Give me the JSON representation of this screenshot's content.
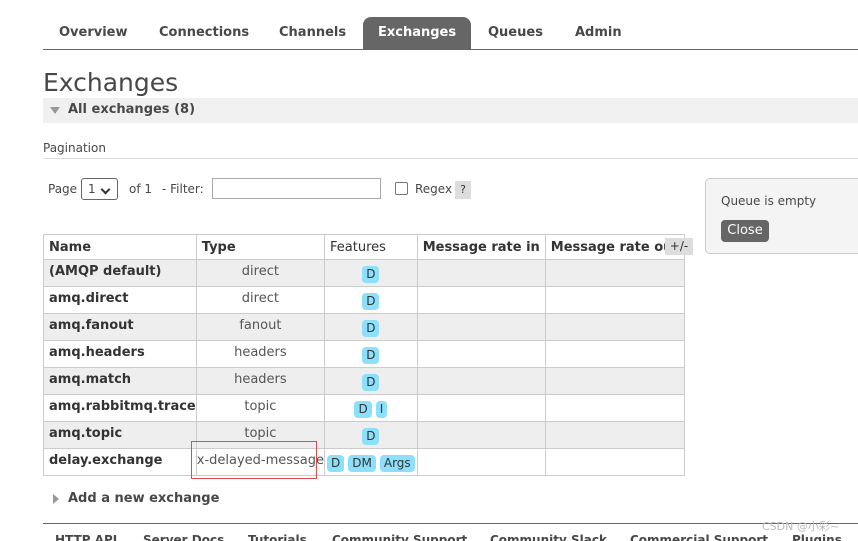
{
  "tabs": [
    {
      "label": "Overview"
    },
    {
      "label": "Connections"
    },
    {
      "label": "Channels"
    },
    {
      "label": "Exchanges",
      "active": true
    },
    {
      "label": "Queues"
    },
    {
      "label": "Admin"
    }
  ],
  "page_title": "Exchanges",
  "section": {
    "label": "All exchanges (8)"
  },
  "pagination": {
    "label": "Pagination",
    "page_label": "Page",
    "page_value": "1",
    "of_text": "of 1",
    "filter_label": "- Filter:",
    "filter_value": "",
    "regex_label": "Regex",
    "help_label": "?"
  },
  "table": {
    "headers": [
      "Name",
      "Type",
      "Features",
      "Message rate in",
      "Message rate out"
    ],
    "plus_minus": "+/-",
    "rows": [
      {
        "name": "(AMQP default)",
        "type": "direct",
        "features": [
          "D"
        ]
      },
      {
        "name": "amq.direct",
        "type": "direct",
        "features": [
          "D"
        ]
      },
      {
        "name": "amq.fanout",
        "type": "fanout",
        "features": [
          "D"
        ]
      },
      {
        "name": "amq.headers",
        "type": "headers",
        "features": [
          "D"
        ]
      },
      {
        "name": "amq.match",
        "type": "headers",
        "features": [
          "D"
        ]
      },
      {
        "name": "amq.rabbitmq.trace",
        "type": "topic",
        "features": [
          "D",
          "I"
        ]
      },
      {
        "name": "amq.topic",
        "type": "topic",
        "features": [
          "D"
        ]
      },
      {
        "name": "delay.exchange",
        "type": "x-delayed-message",
        "features": [
          "D",
          "DM",
          "Args"
        ]
      }
    ]
  },
  "queue_panel": {
    "message": "Queue is empty",
    "close_label": "Close"
  },
  "add_new": {
    "label": "Add a new exchange"
  },
  "footer": [
    "HTTP API",
    "Server Docs",
    "Tutorials",
    "Community Support",
    "Community Slack",
    "Commercial Support",
    "Plugins"
  ],
  "watermark": "CSDN @小彩~",
  "colors": {
    "tab_active": "#666666",
    "badge": "#8ce0fb",
    "highlight": "#e04b4b"
  }
}
